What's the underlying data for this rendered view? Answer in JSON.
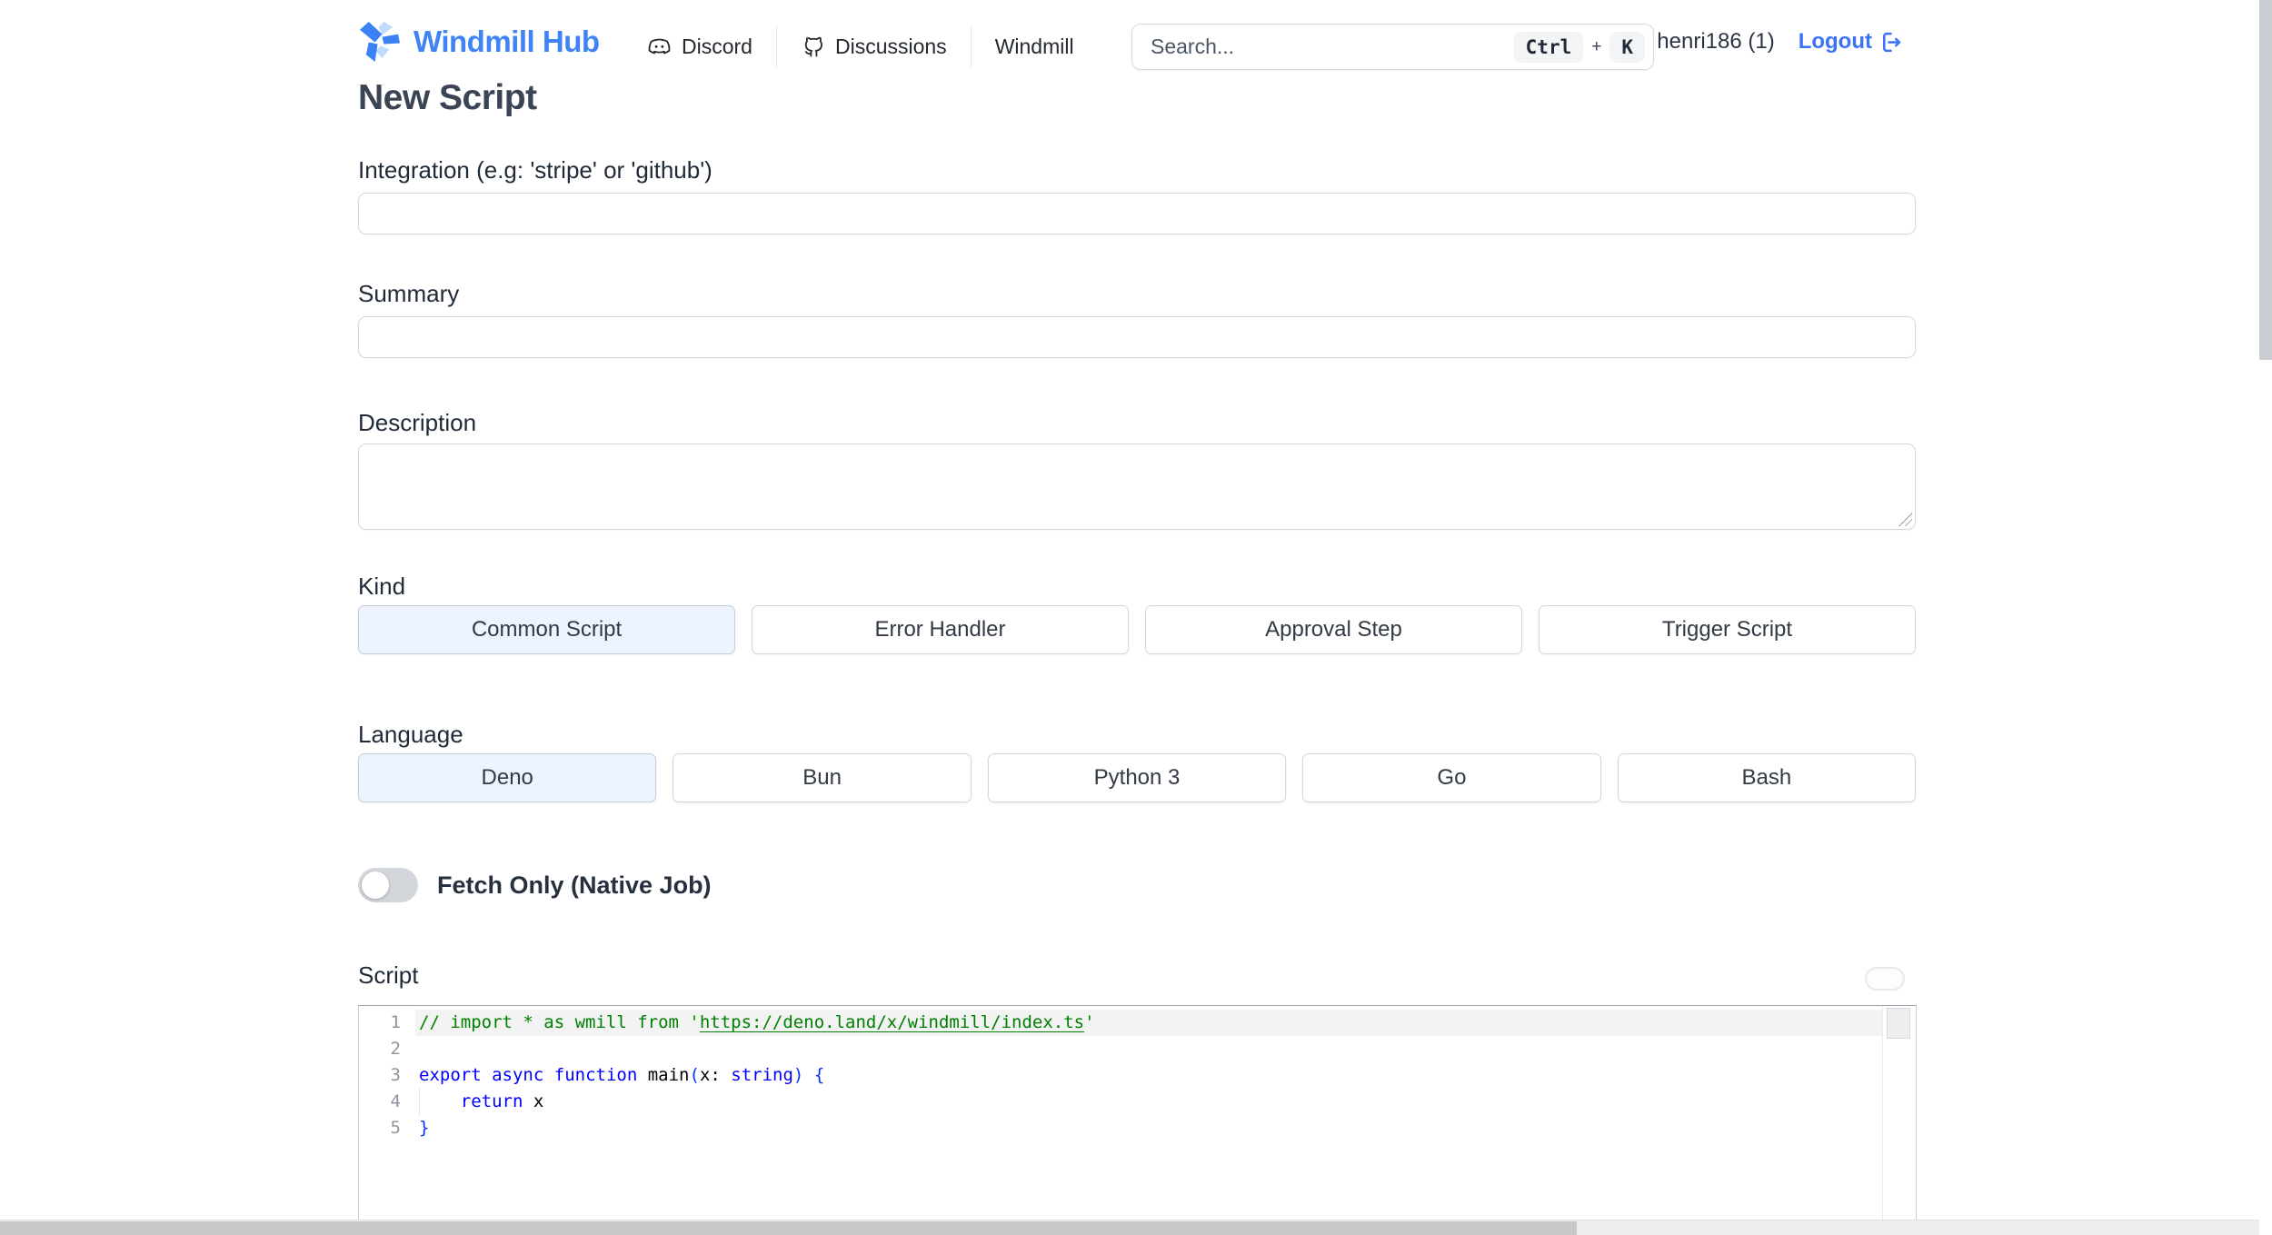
{
  "header": {
    "brand": "Windmill Hub",
    "nav": [
      {
        "label": "Discord",
        "icon": "discord-icon"
      },
      {
        "label": "Discussions",
        "icon": "discussions-icon"
      },
      {
        "label": "Windmill"
      }
    ],
    "search": {
      "placeholder": "Search...",
      "value": "",
      "shortcut_keys": [
        "Ctrl",
        "K"
      ],
      "shortcut_separator": "+"
    },
    "user": "henri186 (1)",
    "logout_label": "Logout"
  },
  "page_title": "New Script",
  "form": {
    "integration_label": "Integration (e.g: 'stripe' or 'github')",
    "integration_value": "",
    "summary_label": "Summary",
    "summary_value": "",
    "description_label": "Description",
    "description_value": "",
    "kind_label": "Kind",
    "kind_options": [
      {
        "label": "Common Script",
        "selected": true
      },
      {
        "label": "Error Handler",
        "selected": false
      },
      {
        "label": "Approval Step",
        "selected": false
      },
      {
        "label": "Trigger Script",
        "selected": false
      }
    ],
    "language_label": "Language",
    "language_options": [
      {
        "label": "Deno",
        "selected": true
      },
      {
        "label": "Bun",
        "selected": false
      },
      {
        "label": "Python 3",
        "selected": false
      },
      {
        "label": "Go",
        "selected": false
      },
      {
        "label": "Bash",
        "selected": false
      }
    ],
    "fetch_only_label": "Fetch Only (Native Job)",
    "fetch_only_enabled": false,
    "script_label": "Script"
  },
  "editor": {
    "token_colors": {
      "comment": "#008000",
      "keyword": "#0000ff",
      "plain": "#000000",
      "bracket": "#0431fa"
    },
    "lines": [
      {
        "number": "1",
        "highlight": true,
        "tokens": [
          {
            "t": "// import * as wmill from '",
            "c": "comment"
          },
          {
            "t": "https://deno.land/x/windmill/index.ts",
            "c": "comment",
            "u": true
          },
          {
            "t": "'",
            "c": "comment"
          }
        ]
      },
      {
        "number": "2",
        "tokens": []
      },
      {
        "number": "3",
        "tokens": [
          {
            "t": "export",
            "c": "keyword"
          },
          {
            "t": " ",
            "c": "plain"
          },
          {
            "t": "async",
            "c": "keyword"
          },
          {
            "t": " ",
            "c": "plain"
          },
          {
            "t": "function",
            "c": "keyword"
          },
          {
            "t": " ",
            "c": "plain"
          },
          {
            "t": "main",
            "c": "plain"
          },
          {
            "t": "(",
            "c": "bracket"
          },
          {
            "t": "x",
            "c": "plain"
          },
          {
            "t": ": ",
            "c": "plain"
          },
          {
            "t": "string",
            "c": "keyword"
          },
          {
            "t": ")",
            "c": "bracket"
          },
          {
            "t": " ",
            "c": "plain"
          },
          {
            "t": "{",
            "c": "bracket"
          }
        ]
      },
      {
        "number": "4",
        "guide": true,
        "tokens": [
          {
            "t": "    ",
            "c": "plain"
          },
          {
            "t": "return",
            "c": "keyword"
          },
          {
            "t": " x",
            "c": "plain"
          }
        ]
      },
      {
        "number": "5",
        "tokens": [
          {
            "t": "}",
            "c": "bracket"
          }
        ]
      }
    ]
  },
  "colors": {
    "brand_blue": "#4083f7",
    "logout_blue": "#3b72f6",
    "title": "#3b4454",
    "selected_option_bg": "#edf4fe",
    "toggle_off": "#d3d7dc"
  }
}
